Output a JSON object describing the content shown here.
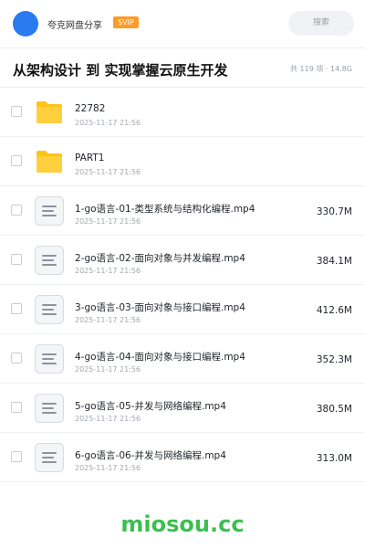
{
  "header": {
    "app_name": "夸克网盘分享",
    "badge": "SVIP",
    "search_label": "搜索"
  },
  "share": {
    "title": "从架构设计 到 实现掌握云原生开发",
    "meta": "共 119 项 · 14.8G"
  },
  "files": [
    {
      "type": "folder",
      "name": "22782",
      "date": "2025-11-17 21:56",
      "size": ""
    },
    {
      "type": "folder",
      "name": "PART1",
      "date": "2025-11-17 21:56",
      "size": ""
    },
    {
      "type": "file",
      "name": "1-go语言-01-类型系统与结构化编程.mp4",
      "date": "2025-11-17 21:56",
      "size": "330.7M"
    },
    {
      "type": "file",
      "name": "2-go语言-02-面向对象与并发编程.mp4",
      "date": "2025-11-17 21:56",
      "size": "384.1M"
    },
    {
      "type": "file",
      "name": "3-go语言-03-面向对象与接口编程.mp4",
      "date": "2025-11-17 21:56",
      "size": "412.6M"
    },
    {
      "type": "file",
      "name": "4-go语言-04-面向对象与接口编程.mp4",
      "date": "2025-11-17 21:56",
      "size": "352.3M"
    },
    {
      "type": "file",
      "name": "5-go语言-05-并发与网络编程.mp4",
      "date": "2025-11-17 21:56",
      "size": "380.5M"
    },
    {
      "type": "file",
      "name": "6-go语言-06-并发与网络编程.mp4",
      "date": "2025-11-17 21:56",
      "size": "313.0M"
    }
  ],
  "watermark": "miosou.cc",
  "colors": {
    "avatar": "#2b7bf0",
    "svip": "#ff9b26",
    "folder": "#ffc21a",
    "watermark": "#3cbf4f"
  }
}
